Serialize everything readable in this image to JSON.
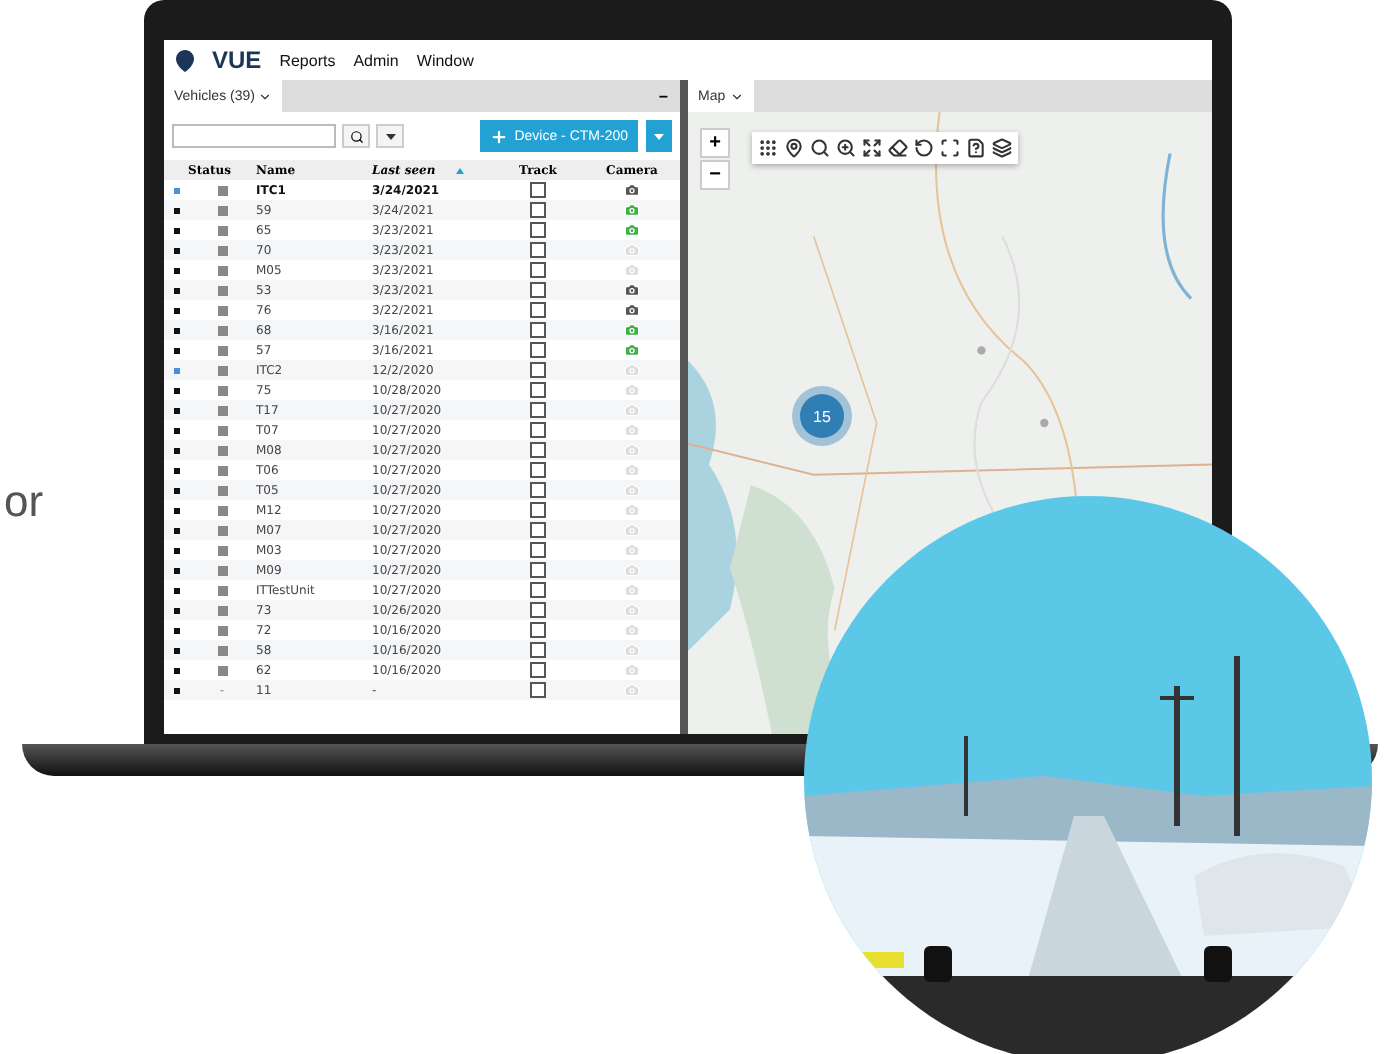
{
  "side_text": "or",
  "app": {
    "logo": "VUE",
    "menu": [
      "Reports",
      "Admin",
      "Window"
    ]
  },
  "vehicles_panel": {
    "tab": {
      "label": "Vehicles (39)",
      "selected": true
    },
    "minimize": "−",
    "add_button": "Device - CTM-200",
    "columns": [
      "Status",
      "Name",
      "Last seen",
      "Track",
      "Camera"
    ],
    "rows": [
      {
        "color": "#4a90d9",
        "name": "ITC1",
        "last_seen": "3/24/2021",
        "bold": true,
        "track": false,
        "camera": {
          "color": "#555555"
        }
      },
      {
        "color": "#111111",
        "name": "59",
        "last_seen": "3/24/2021",
        "bold": false,
        "track": false,
        "camera": {
          "color": "#3cb043"
        }
      },
      {
        "color": "#111111",
        "name": "65",
        "last_seen": "3/23/2021",
        "bold": false,
        "track": false,
        "camera": {
          "color": "#3cb043"
        }
      },
      {
        "color": "#111111",
        "name": "70",
        "last_seen": "3/23/2021",
        "bold": false,
        "track": false,
        "camera": {
          "color": "#dddddd"
        }
      },
      {
        "color": "#111111",
        "name": "M05",
        "last_seen": "3/23/2021",
        "bold": false,
        "track": false,
        "camera": {
          "color": "#dddddd"
        }
      },
      {
        "color": "#111111",
        "name": "53",
        "last_seen": "3/23/2021",
        "bold": false,
        "track": false,
        "camera": {
          "color": "#555555"
        }
      },
      {
        "color": "#111111",
        "name": "76",
        "last_seen": "3/22/2021",
        "bold": false,
        "track": false,
        "camera": {
          "color": "#555555"
        }
      },
      {
        "color": "#111111",
        "name": "68",
        "last_seen": "3/16/2021",
        "bold": false,
        "track": false,
        "camera": {
          "color": "#3cb043"
        }
      },
      {
        "color": "#111111",
        "name": "57",
        "last_seen": "3/16/2021",
        "bold": false,
        "track": false,
        "camera": {
          "color": "#3cb043"
        }
      },
      {
        "color": "#4a90d9",
        "name": "ITC2",
        "last_seen": "12/2/2020",
        "bold": false,
        "track": false,
        "camera": {
          "color": "#dddddd"
        }
      },
      {
        "color": "#111111",
        "name": "75",
        "last_seen": "10/28/2020",
        "bold": false,
        "track": false,
        "camera": {
          "color": "#dddddd"
        }
      },
      {
        "color": "#111111",
        "name": "T17",
        "last_seen": "10/27/2020",
        "bold": false,
        "track": false,
        "camera": {
          "color": "#dddddd"
        }
      },
      {
        "color": "#111111",
        "name": "T07",
        "last_seen": "10/27/2020",
        "bold": false,
        "track": false,
        "camera": {
          "color": "#dddddd"
        }
      },
      {
        "color": "#111111",
        "name": "M08",
        "last_seen": "10/27/2020",
        "bold": false,
        "track": false,
        "camera": {
          "color": "#dddddd"
        }
      },
      {
        "color": "#111111",
        "name": "T06",
        "last_seen": "10/27/2020",
        "bold": false,
        "track": false,
        "camera": {
          "color": "#dddddd"
        }
      },
      {
        "color": "#111111",
        "name": "T05",
        "last_seen": "10/27/2020",
        "bold": false,
        "track": false,
        "camera": {
          "color": "#dddddd"
        }
      },
      {
        "color": "#111111",
        "name": "M12",
        "last_seen": "10/27/2020",
        "bold": false,
        "track": false,
        "camera": {
          "color": "#dddddd"
        }
      },
      {
        "color": "#111111",
        "name": "M07",
        "last_seen": "10/27/2020",
        "bold": false,
        "track": false,
        "camera": {
          "color": "#dddddd"
        }
      },
      {
        "color": "#111111",
        "name": "M03",
        "last_seen": "10/27/2020",
        "bold": false,
        "track": false,
        "camera": {
          "color": "#dddddd"
        }
      },
      {
        "color": "#111111",
        "name": "M09",
        "last_seen": "10/27/2020",
        "bold": false,
        "track": false,
        "camera": {
          "color": "#dddddd"
        }
      },
      {
        "color": "#111111",
        "name": "ITTestUnit",
        "last_seen": "10/27/2020",
        "bold": false,
        "track": false,
        "camera": {
          "color": "#dddddd"
        }
      },
      {
        "color": "#111111",
        "name": "73",
        "last_seen": "10/26/2020",
        "bold": false,
        "track": false,
        "camera": {
          "color": "#dddddd"
        }
      },
      {
        "color": "#111111",
        "name": "72",
        "last_seen": "10/16/2020",
        "bold": false,
        "track": false,
        "camera": {
          "color": "#dddddd"
        }
      },
      {
        "color": "#111111",
        "name": "58",
        "last_seen": "10/16/2020",
        "bold": false,
        "track": false,
        "camera": {
          "color": "#dddddd"
        }
      },
      {
        "color": "#111111",
        "name": "62",
        "last_seen": "10/16/2020",
        "bold": false,
        "track": false,
        "camera": {
          "color": "#dddddd"
        }
      },
      {
        "color": "#111111",
        "status": "-",
        "name": "11",
        "last_seen": "-",
        "bold": false,
        "track": false,
        "camera": {
          "color": "#dddddd"
        }
      }
    ]
  },
  "map_panel": {
    "tab": {
      "label": "Map",
      "selected": true
    },
    "zoom_in": "+",
    "zoom_out": "−",
    "cluster": "15"
  }
}
